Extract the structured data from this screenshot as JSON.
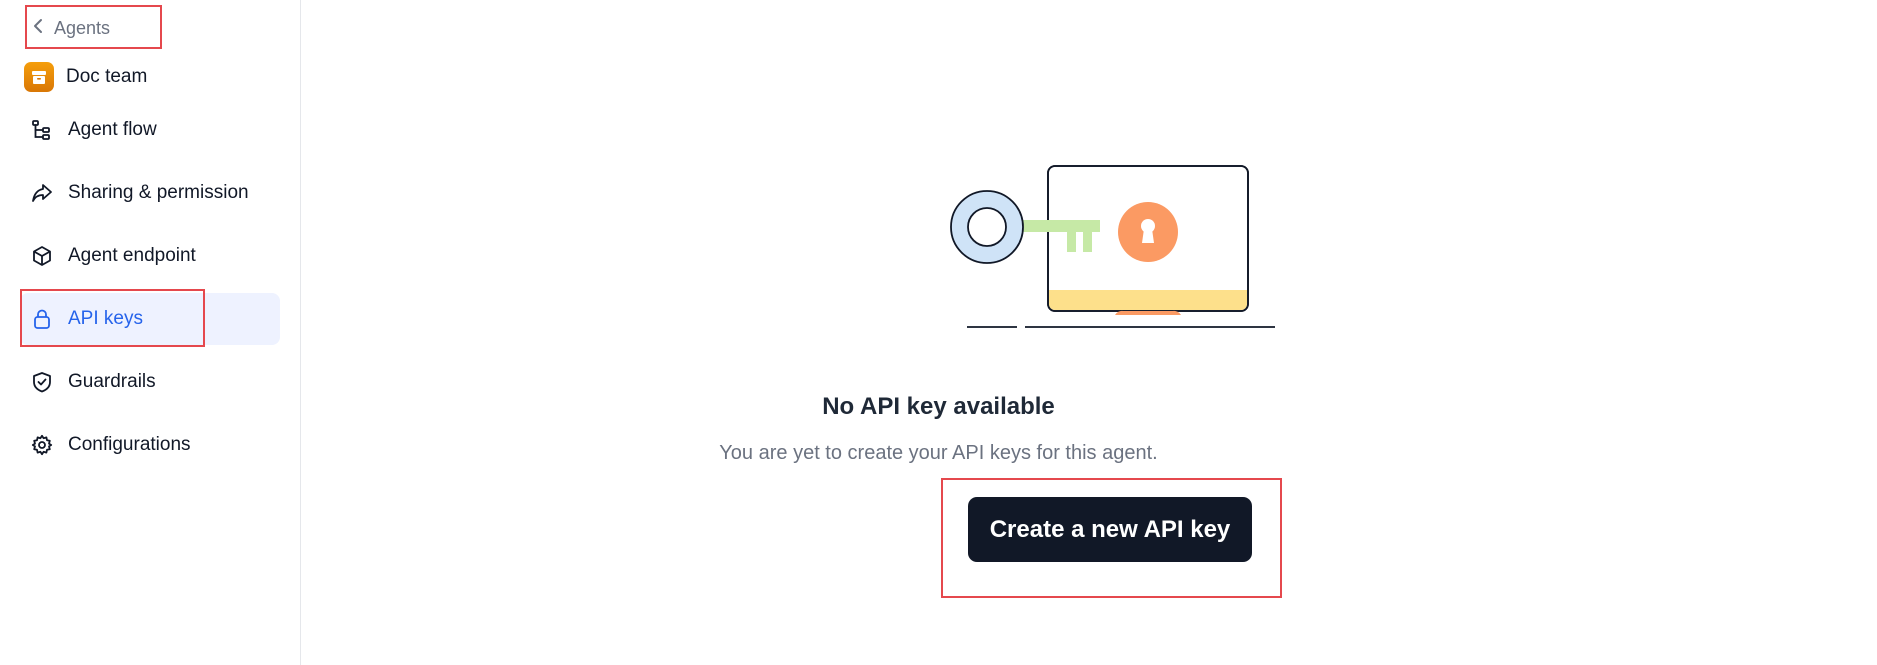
{
  "sidebar": {
    "back_label": "Agents",
    "team_name": "Doc team",
    "items": [
      {
        "label": "Agent flow",
        "icon": "flow-icon"
      },
      {
        "label": "Sharing & permission",
        "icon": "share-icon"
      },
      {
        "label": "Agent endpoint",
        "icon": "cube-icon"
      },
      {
        "label": "API keys",
        "icon": "lock-icon",
        "active": true
      },
      {
        "label": "Guardrails",
        "icon": "shield-check-icon"
      },
      {
        "label": "Configurations",
        "icon": "gear-icon"
      }
    ]
  },
  "empty_state": {
    "title": "No API key available",
    "subtitle": "You are yet to create your API keys for this agent.",
    "button_label": "Create a new API key"
  },
  "colors": {
    "accent": "#2563eb",
    "active_bg": "#eef2ff",
    "button_bg": "#111827",
    "highlight": "#e5484d",
    "key_ring": "#cfe3f7",
    "key_shaft": "#c6e9a6",
    "lock_orange": "#fb9a63",
    "screen_strip": "#fde08b"
  }
}
